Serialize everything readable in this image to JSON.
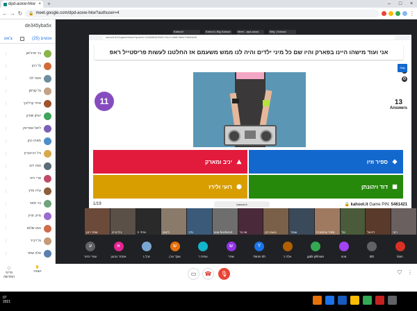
{
  "browser": {
    "tab_title": "dpd-aoxw-hkw",
    "url": "meet.google.com/dpd-aoxw-hkw?authuser=4",
    "share_tabs": [
      "Kahoot!",
      "Kahoot | Big Kahoot",
      "Meet - dpd-aoxw-hkw",
      "Bitly | Kahoot"
    ],
    "share_url": "kahoot.it/v2/gameblock?quizId=12a348b6-f6b9-43c1-b4b8-9a0c70bd0a2b"
  },
  "panel": {
    "meeting_code": "de345yba5x",
    "tab_people": "אנשים (25)",
    "tab_chat": "צ'אט",
    "participants": [
      {
        "name": "בר פרג'יאן",
        "color": "#8ab34a"
      },
      {
        "name": "גל כהן",
        "color": "#d26a3b"
      },
      {
        "name": "נועה לבי",
        "color": "#6c8e9e"
      },
      {
        "name": "גל קורמן",
        "color": "#c5a285"
      },
      {
        "name": "איתי קרליבך",
        "color": "#a0522d"
      },
      {
        "name": "יונתן שורק",
        "color": "#3ea55a"
      },
      {
        "name": "ליאל אפרימן",
        "color": "#7b61b5"
      },
      {
        "name": "מאיה כהן",
        "color": "#4f8dc9"
      },
      {
        "name": "גיל רבינוביץ",
        "color": "#d7a94a"
      },
      {
        "name": "נוגה יהב",
        "color": "#5b6b7b"
      },
      {
        "name": "ארי וייס",
        "color": "#c04a6a"
      },
      {
        "name": "עידו פרץ",
        "color": "#8b5e3c"
      },
      {
        "name": "בר מוטי",
        "color": "#6fa37d"
      },
      {
        "name": "מייב פרץ",
        "color": "#9c6ad0"
      },
      {
        "name": "נטע שלום",
        "color": "#d06b4b"
      },
      {
        "name": "גל דביר",
        "color": "#c49a78"
      },
      {
        "name": "אלה שחר",
        "color": "#5a7fb0"
      }
    ]
  },
  "kahoot": {
    "question": "אני ועוד מישהו היינו בפארק והיו שם כל מיני ילדים והיה לנו ממש משעמם אז החלטנו לעשות פריסטייל ראפ",
    "timer": "11",
    "answers_count": "13",
    "answers_label": "Answers",
    "skip_label": "Skip",
    "options": [
      {
        "text": "יניב ומארק",
        "shape": "triangle"
      },
      {
        "text": "ספיר וזיו",
        "shape": "diamond"
      },
      {
        "text": "רועי ולירז",
        "shape": "circle"
      },
      {
        "text": "דוד ויהונתן",
        "shape": "square"
      }
    ],
    "page": "1/19",
    "footer_mid": "kahoot.it",
    "brand": "kahoot.it",
    "pin_label": "Game PIN:",
    "pin": "5461421"
  },
  "tiles": [
    {
      "name": "שחר רונן",
      "color": "#6b4a3a"
    },
    {
      "name": "גיל טייב",
      "color": "#5a5048"
    },
    {
      "name": "איתי ה",
      "color": "#2a2a2a"
    },
    {
      "name": "ליאם",
      "color": "#8a7a6a"
    },
    {
      "name": "נדב",
      "color": "#3b5a7a"
    },
    {
      "name": "noa hocherot",
      "color": "#6e6e6e"
    },
    {
      "name": "שי בר",
      "color": "#4a2a3a"
    },
    {
      "name": "נועם כהן",
      "color": "#7a6048"
    },
    {
      "name": "עומר",
      "color": "#3a4a5a"
    },
    {
      "name": "ספיר ארגמנית",
      "color": "#a07a60"
    },
    {
      "name": "טל",
      "color": "#4a5a3a"
    },
    {
      "name": "דניאל",
      "color": "#5a3a2a"
    },
    {
      "name": "רוני",
      "color": "#6a6060"
    }
  ],
  "small_avatars": [
    {
      "initial": "ע",
      "name": "עמרי מזור",
      "color": "#5f6368"
    },
    {
      "initial": "א",
      "name": "אסתר גבעון",
      "color": "#e52592"
    },
    {
      "initial": "",
      "name": "יובל ג",
      "color": "#7aa6d2"
    },
    {
      "initial": "ש",
      "name": "שקד גורן",
      "color": "#e8710a"
    },
    {
      "initial": "",
      "name": "עמית ר",
      "color": "#12b5cb"
    },
    {
      "initial": "ש",
      "name": "שחר",
      "color": "#9334e6"
    },
    {
      "initial": "Y",
      "name": "Yaniv Sh",
      "color": "#1a73e8"
    },
    {
      "initial": "",
      "name": "אלה כ",
      "color": "#b06000"
    },
    {
      "initial": "",
      "name": "gabi pillman",
      "color": "#34a853"
    },
    {
      "initial": "",
      "name": "noa",
      "color": "#a142f4"
    },
    {
      "initial": "",
      "name": "BD",
      "color": "#5f6368"
    },
    {
      "initial": "",
      "name": "liam",
      "color": "#d93025"
    }
  ],
  "bottom": {
    "details": "פרטי הפגישה",
    "present": "הצגה",
    "mic_icon": "mic-icon",
    "cam_icon": "camera-icon",
    "hangup_icon": "hangup-icon"
  },
  "taskbar": {
    "time": "07",
    "date": "2021"
  }
}
